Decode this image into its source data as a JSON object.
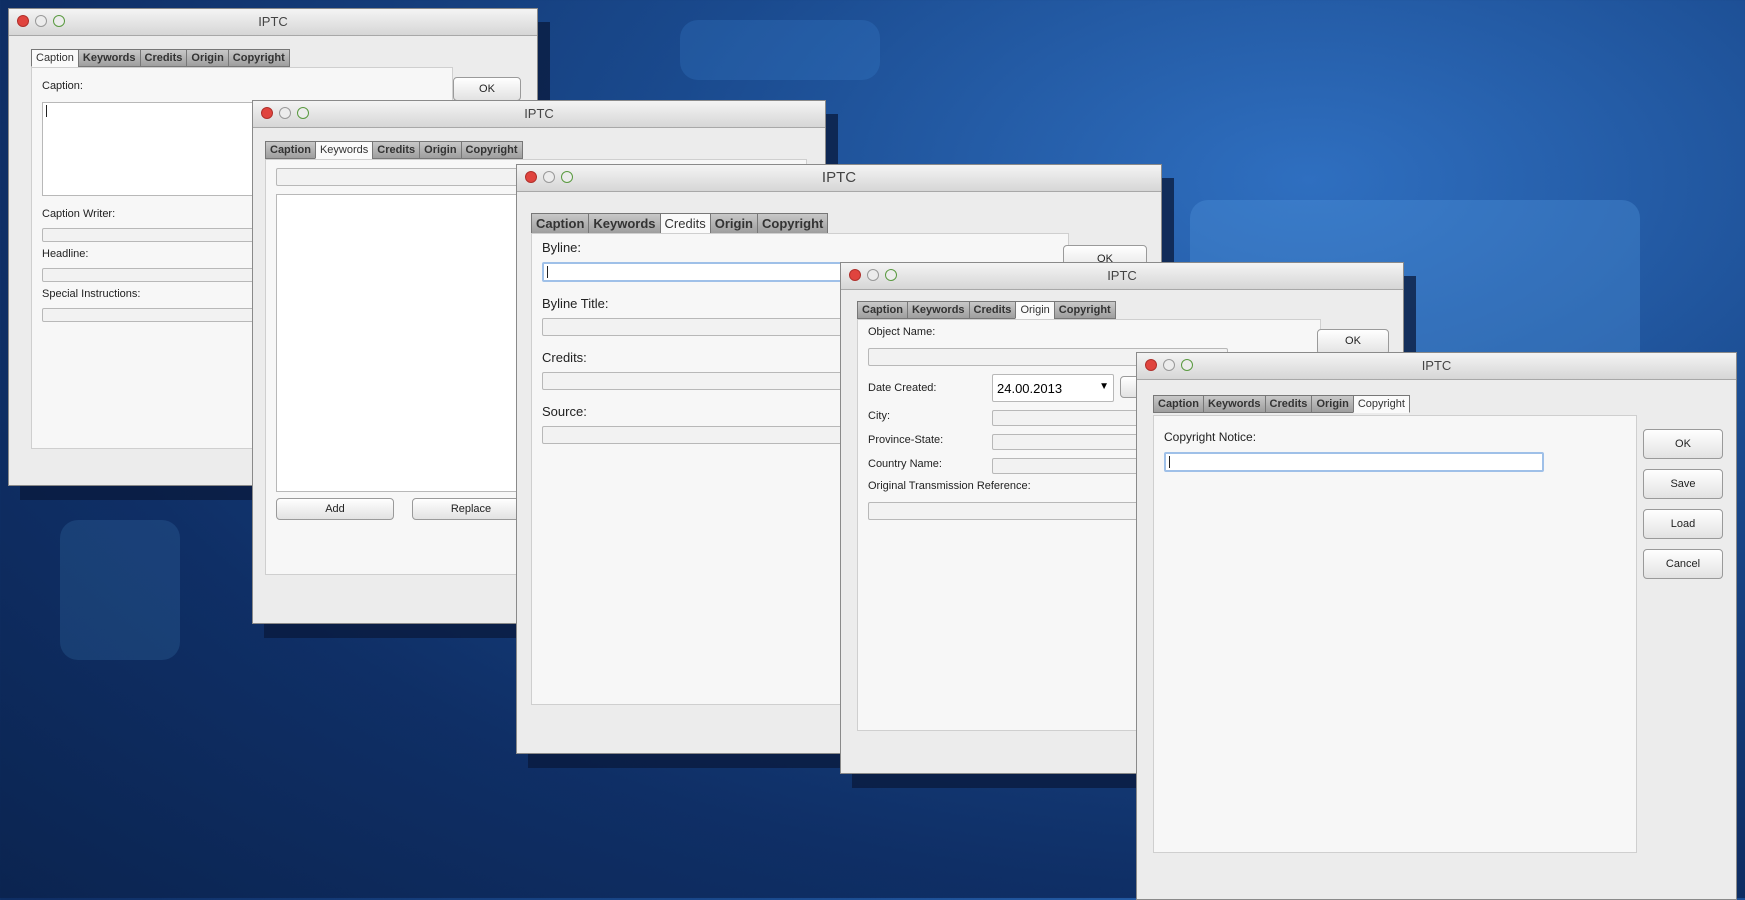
{
  "window_title": "IPTC",
  "tabs": [
    "Caption",
    "Keywords",
    "Credits",
    "Origin",
    "Copyright"
  ],
  "caption_window": {
    "caption_label": "Caption:",
    "caption_writer_label": "Caption Writer:",
    "headline_label": "Headline:",
    "special_instructions_label": "Special Instructions:",
    "ok_label": "OK"
  },
  "keywords_window": {
    "add_label": "Add",
    "replace_label": "Replace"
  },
  "credits_window": {
    "byline_label": "Byline:",
    "byline_title_label": "Byline Title:",
    "credits_label": "Credits:",
    "source_label": "Source:",
    "ok_label": "OK"
  },
  "origin_window": {
    "object_name_label": "Object Name:",
    "date_created_label": "Date Created:",
    "date_value": "24.00.2013",
    "city_label": "City:",
    "province_state_label": "Province-State:",
    "country_name_label": "Country Name:",
    "otr_label": "Original Transmission Reference:",
    "ok_label": "OK"
  },
  "copyright_window": {
    "copyright_notice_label": "Copyright Notice:",
    "ok_label": "OK",
    "save_label": "Save",
    "load_label": "Load",
    "cancel_label": "Cancel"
  },
  "colors": {
    "background": "#1a4a8e",
    "close_button": "#e0443e",
    "window": "#ececec"
  }
}
